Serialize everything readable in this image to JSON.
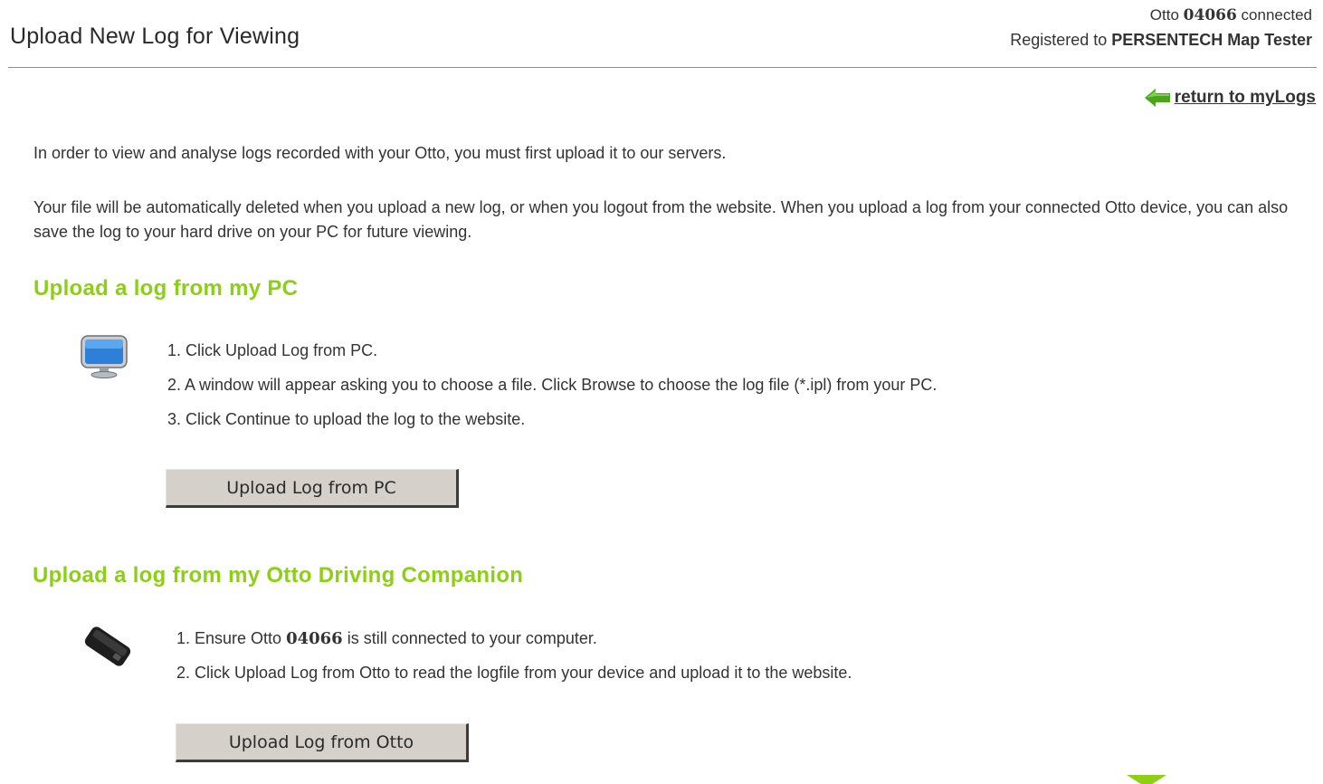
{
  "header": {
    "title": "Upload New Log for Viewing",
    "connection": {
      "prefix": "Otto",
      "device_id": "04066",
      "suffix": "connected"
    },
    "registration": {
      "prefix": "Registered to",
      "owner": "PERSENTECH Map Tester"
    }
  },
  "return_link": {
    "label": "return to myLogs",
    "icon": "left-arrow-icon"
  },
  "intro": {
    "paragraph1": "In order to view and analyse logs recorded with your Otto, you must first upload it to our servers.",
    "paragraph2": "Your file will be automatically deleted when you upload a new log, or when you logout from the website. When you upload a log from your connected Otto device, you can also save the log to your hard drive on your PC for future viewing."
  },
  "pc_section": {
    "heading": "Upload a log from my PC",
    "icon": "monitor-icon",
    "steps": [
      "1. Click Upload Log from PC.",
      "2. A window will appear asking you to choose a file. Click Browse to choose the log file (*.ipl) from your PC.",
      "3. Click Continue to upload the log to the website."
    ],
    "button_label": "Upload Log from PC"
  },
  "otto_section": {
    "heading": "Upload a log from my Otto Driving Companion",
    "icon": "device-icon",
    "steps": {
      "step1_prefix": "1. Ensure Otto",
      "step1_device": "04066",
      "step1_suffix": "is still connected to your computer.",
      "step2": "2. Click Upload Log from Otto to read the logfile from your device and upload it to the website."
    },
    "button_label": "Upload Log from Otto"
  },
  "colors": {
    "heading_green": "#8ccf15",
    "arrow_green": "#4aa51c",
    "button_face": "#d5d1ca",
    "divider": "#8f8f8f"
  }
}
